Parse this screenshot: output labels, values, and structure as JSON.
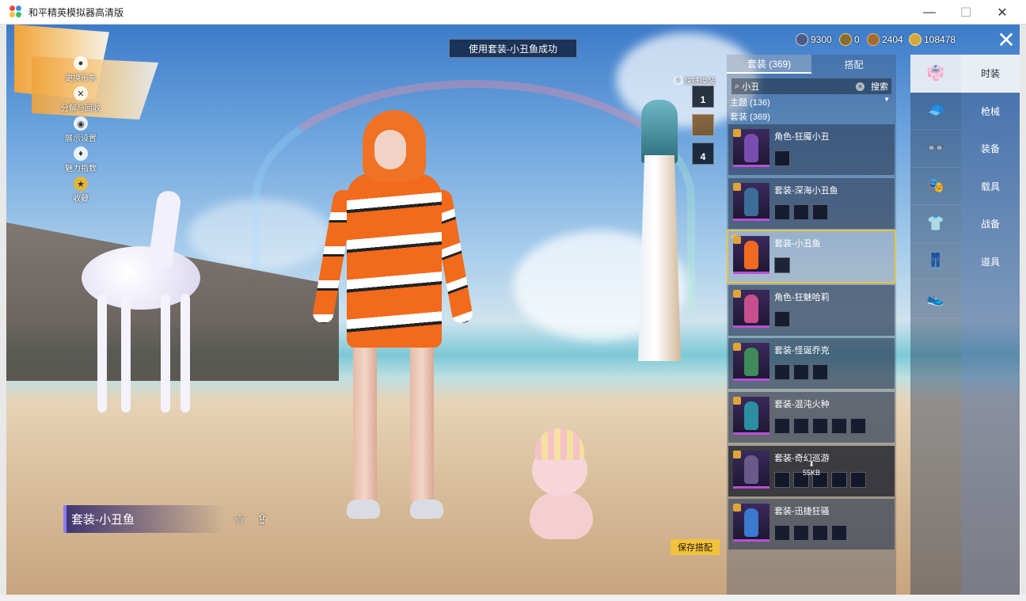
{
  "window": {
    "title": "和平精英模拟器高清版",
    "minimize": "—",
    "maximize": "☐",
    "close": "✕"
  },
  "toast": "使用套装-小丑鱼成功",
  "left_menu": [
    {
      "label": "更换形象",
      "icon": "person-icon"
    },
    {
      "label": "分解与回收",
      "icon": "recycle-icon"
    },
    {
      "label": "展示设置",
      "icon": "eye-icon"
    },
    {
      "label": "魅力指数",
      "icon": "charm-icon"
    },
    {
      "label": "收藏",
      "icon": "collection-icon"
    }
  ],
  "currency": [
    {
      "value": "9300",
      "icon": "globe-coin-icon",
      "color": "#4d5a8a"
    },
    {
      "value": "0",
      "icon": "badge-coin-icon",
      "color": "#8a6d2e"
    },
    {
      "value": "2404",
      "icon": "bronze-coin-icon",
      "color": "#a36b2e"
    },
    {
      "value": "108478",
      "icon": "gold-coin-icon",
      "color": "#d4a93a"
    }
  ],
  "quick_swap": {
    "label": "快捷换装",
    "slots": [
      "1",
      "",
      "4"
    ]
  },
  "panel": {
    "tabs": [
      {
        "label": "套装 (369)",
        "active": true
      },
      {
        "label": "搭配",
        "active": false
      }
    ],
    "search_value": "小丑",
    "search_button": "搜索",
    "clear": "×",
    "filter": "主题 (136)",
    "count": "套装 (369)",
    "items": [
      {
        "name": "角色-狂魇小丑",
        "minis": 1,
        "color": "#7a4db0"
      },
      {
        "name": "套装-深海小丑鱼",
        "minis": 3,
        "color": "#3c6c9a"
      },
      {
        "name": "套装-小丑鱼",
        "minis": 1,
        "color": "#f06a22",
        "selected": true
      },
      {
        "name": "角色-狂魅哈莉",
        "minis": 1,
        "color": "#c84f8e"
      },
      {
        "name": "套装-怪诞乔克",
        "minis": 3,
        "color": "#3e8a5a"
      },
      {
        "name": "套装-混沌火种",
        "minis": 5,
        "color": "#2c8ea3"
      },
      {
        "name": "套装-奇幻巡游",
        "minis": 5,
        "color": "#6a5a8a",
        "download": "55KB"
      },
      {
        "name": "套装-迅捷狂骚",
        "minis": 4,
        "color": "#3a7ad0"
      }
    ]
  },
  "categories": [
    {
      "icon": "outfit-icon",
      "glyph": "👘",
      "active": true
    },
    {
      "icon": "cap-icon",
      "glyph": "🧢"
    },
    {
      "icon": "glasses-icon",
      "glyph": "👓"
    },
    {
      "icon": "mask-icon",
      "glyph": "🎭"
    },
    {
      "icon": "top-icon",
      "glyph": "👕"
    },
    {
      "icon": "pants-icon",
      "glyph": "👖"
    },
    {
      "icon": "shoes-icon",
      "glyph": "👟"
    }
  ],
  "nav": [
    {
      "label": "时装",
      "active": true
    },
    {
      "label": "枪械"
    },
    {
      "label": "装备"
    },
    {
      "label": "载具"
    },
    {
      "label": "战备"
    },
    {
      "label": "道具"
    }
  ],
  "outfit_name": "套装-小丑鱼",
  "save_button": "保存搭配"
}
